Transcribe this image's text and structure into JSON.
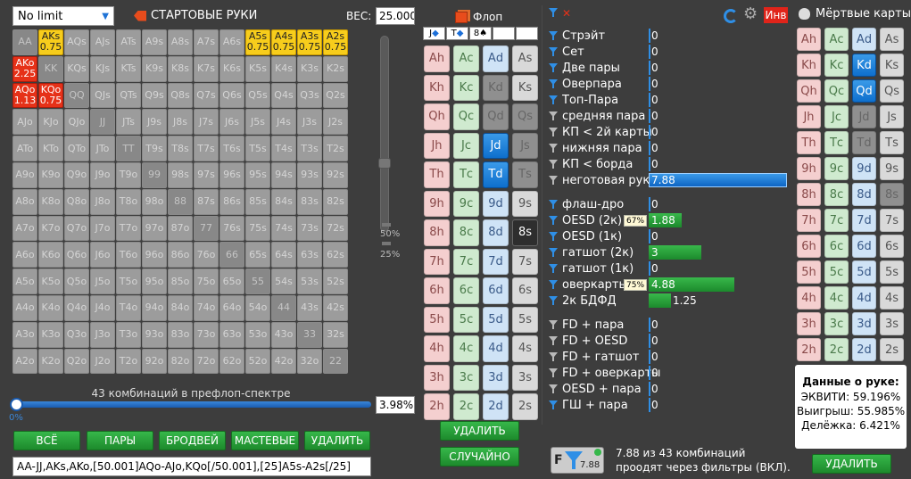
{
  "preset": {
    "value": "No limit"
  },
  "start_hands": {
    "label": "СТАРТОВЫЕ РУКИ"
  },
  "weight": {
    "label": "ВЕС:",
    "value": "25.000"
  },
  "hand_grid": [
    [
      {
        "t": "AA",
        "k": "pair"
      },
      {
        "t": "AKs",
        "w": "0.75",
        "k": "yellow"
      },
      {
        "t": "AQs"
      },
      {
        "t": "AJs"
      },
      {
        "t": "ATs"
      },
      {
        "t": "A9s"
      },
      {
        "t": "A8s"
      },
      {
        "t": "A7s"
      },
      {
        "t": "A6s"
      },
      {
        "t": "A5s",
        "w": "0.75",
        "k": "yellow"
      },
      {
        "t": "A4s",
        "w": "0.75",
        "k": "yellow"
      },
      {
        "t": "A3s",
        "w": "0.75",
        "k": "yellow"
      },
      {
        "t": "A2s",
        "w": "0.75",
        "k": "yellow"
      }
    ],
    [
      {
        "t": "AKo",
        "w": "2.25",
        "k": "red"
      },
      {
        "t": "KK",
        "k": "pair"
      },
      {
        "t": "KQs"
      },
      {
        "t": "KJs"
      },
      {
        "t": "KTs"
      },
      {
        "t": "K9s"
      },
      {
        "t": "K8s"
      },
      {
        "t": "K7s"
      },
      {
        "t": "K6s"
      },
      {
        "t": "K5s"
      },
      {
        "t": "K4s"
      },
      {
        "t": "K3s"
      },
      {
        "t": "K2s"
      }
    ],
    [
      {
        "t": "AQo",
        "w": "1.13",
        "k": "red"
      },
      {
        "t": "KQo",
        "w": "0.75",
        "k": "red"
      },
      {
        "t": "QQ",
        "k": "pair"
      },
      {
        "t": "QJs"
      },
      {
        "t": "QTs"
      },
      {
        "t": "Q9s"
      },
      {
        "t": "Q8s"
      },
      {
        "t": "Q7s"
      },
      {
        "t": "Q6s"
      },
      {
        "t": "Q5s"
      },
      {
        "t": "Q4s"
      },
      {
        "t": "Q3s"
      },
      {
        "t": "Q2s"
      }
    ],
    [
      {
        "t": "AJo"
      },
      {
        "t": "KJo"
      },
      {
        "t": "QJo"
      },
      {
        "t": "JJ",
        "k": "pair"
      },
      {
        "t": "JTs"
      },
      {
        "t": "J9s"
      },
      {
        "t": "J8s"
      },
      {
        "t": "J7s"
      },
      {
        "t": "J6s"
      },
      {
        "t": "J5s"
      },
      {
        "t": "J4s"
      },
      {
        "t": "J3s"
      },
      {
        "t": "J2s"
      }
    ],
    [
      {
        "t": "ATo"
      },
      {
        "t": "KTo"
      },
      {
        "t": "QTo"
      },
      {
        "t": "JTo"
      },
      {
        "t": "TT",
        "k": "pair"
      },
      {
        "t": "T9s"
      },
      {
        "t": "T8s"
      },
      {
        "t": "T7s"
      },
      {
        "t": "T6s"
      },
      {
        "t": "T5s"
      },
      {
        "t": "T4s"
      },
      {
        "t": "T3s"
      },
      {
        "t": "T2s"
      }
    ],
    [
      {
        "t": "A9o"
      },
      {
        "t": "K9o"
      },
      {
        "t": "Q9o"
      },
      {
        "t": "J9o"
      },
      {
        "t": "T9o"
      },
      {
        "t": "99",
        "k": "pair"
      },
      {
        "t": "98s"
      },
      {
        "t": "97s"
      },
      {
        "t": "96s"
      },
      {
        "t": "95s"
      },
      {
        "t": "94s"
      },
      {
        "t": "93s"
      },
      {
        "t": "92s"
      }
    ],
    [
      {
        "t": "A8o"
      },
      {
        "t": "K8o"
      },
      {
        "t": "Q8o"
      },
      {
        "t": "J8o"
      },
      {
        "t": "T8o"
      },
      {
        "t": "98o"
      },
      {
        "t": "88",
        "k": "pair"
      },
      {
        "t": "87s"
      },
      {
        "t": "86s"
      },
      {
        "t": "85s"
      },
      {
        "t": "84s"
      },
      {
        "t": "83s"
      },
      {
        "t": "82s"
      }
    ],
    [
      {
        "t": "A7o"
      },
      {
        "t": "K7o"
      },
      {
        "t": "Q7o"
      },
      {
        "t": "J7o"
      },
      {
        "t": "T7o"
      },
      {
        "t": "97o"
      },
      {
        "t": "87o"
      },
      {
        "t": "77",
        "k": "pair"
      },
      {
        "t": "76s"
      },
      {
        "t": "75s"
      },
      {
        "t": "74s"
      },
      {
        "t": "73s"
      },
      {
        "t": "72s"
      }
    ],
    [
      {
        "t": "A6o"
      },
      {
        "t": "K6o"
      },
      {
        "t": "Q6o"
      },
      {
        "t": "J6o"
      },
      {
        "t": "T6o"
      },
      {
        "t": "96o"
      },
      {
        "t": "86o"
      },
      {
        "t": "76o"
      },
      {
        "t": "66",
        "k": "pair"
      },
      {
        "t": "65s"
      },
      {
        "t": "64s"
      },
      {
        "t": "63s"
      },
      {
        "t": "62s"
      }
    ],
    [
      {
        "t": "A5o"
      },
      {
        "t": "K5o"
      },
      {
        "t": "Q5o"
      },
      {
        "t": "J5o"
      },
      {
        "t": "T5o"
      },
      {
        "t": "95o"
      },
      {
        "t": "85o"
      },
      {
        "t": "75o"
      },
      {
        "t": "65o"
      },
      {
        "t": "55",
        "k": "pair"
      },
      {
        "t": "54s"
      },
      {
        "t": "53s"
      },
      {
        "t": "52s"
      }
    ],
    [
      {
        "t": "A4o"
      },
      {
        "t": "K4o"
      },
      {
        "t": "Q4o"
      },
      {
        "t": "J4o"
      },
      {
        "t": "T4o"
      },
      {
        "t": "94o"
      },
      {
        "t": "84o"
      },
      {
        "t": "74o"
      },
      {
        "t": "64o"
      },
      {
        "t": "54o"
      },
      {
        "t": "44",
        "k": "pair"
      },
      {
        "t": "43s"
      },
      {
        "t": "42s"
      }
    ],
    [
      {
        "t": "A3o"
      },
      {
        "t": "K3o"
      },
      {
        "t": "Q3o"
      },
      {
        "t": "J3o"
      },
      {
        "t": "T3o"
      },
      {
        "t": "93o"
      },
      {
        "t": "83o"
      },
      {
        "t": "73o"
      },
      {
        "t": "63o"
      },
      {
        "t": "53o"
      },
      {
        "t": "43o"
      },
      {
        "t": "33",
        "k": "pair"
      },
      {
        "t": "32s"
      }
    ],
    [
      {
        "t": "A2o"
      },
      {
        "t": "K2o"
      },
      {
        "t": "Q2o"
      },
      {
        "t": "J2o"
      },
      {
        "t": "T2o"
      },
      {
        "t": "92o"
      },
      {
        "t": "82o"
      },
      {
        "t": "72o"
      },
      {
        "t": "62o"
      },
      {
        "t": "52o"
      },
      {
        "t": "42o"
      },
      {
        "t": "32o"
      },
      {
        "t": "22",
        "k": "pair"
      }
    ]
  ],
  "weight_slider": {
    "mark_50": "50%",
    "mark_25": "25%"
  },
  "range_slider": {
    "combos_label": "43 комбинаций в префлоп-спектре",
    "min_label": "0%",
    "percent": "3.98%",
    "fill": 0.0
  },
  "range_buttons": {
    "all": "ВСЁ",
    "pairs": "ПАРЫ",
    "broadway": "БРОДВЕЙ",
    "suited": "МАСТЕВЫЕ",
    "delete": "УДАЛИТЬ"
  },
  "range_text": "AA-JJ,AKs,AKo,[50.001]AQo-AJo,KQo[/50.001],[25]A5s-A2s[/25]",
  "flop": {
    "title": "Флоп",
    "slots": [
      {
        "rank": "J",
        "suit": "◆"
      },
      {
        "rank": "T",
        "suit": "◆"
      },
      {
        "rank": "8",
        "suit": "♠"
      },
      {
        "rank": "",
        "suit": ""
      },
      {
        "rank": "",
        "suit": ""
      }
    ],
    "ranks": [
      "A",
      "K",
      "Q",
      "J",
      "T",
      "9",
      "8",
      "7",
      "6",
      "5",
      "4",
      "3",
      "2"
    ],
    "suits": [
      "h",
      "c",
      "d",
      "s"
    ],
    "selected": [
      "Jd",
      "Td",
      "8s"
    ],
    "unavailable": [
      "Kd",
      "Qd",
      "Qs",
      "Js",
      "Ts"
    ],
    "delete_label": "УДАЛИТЬ",
    "random_label": "СЛУЧАЙНО"
  },
  "filters": {
    "inv_label": "Инв",
    "groups": [
      [
        {
          "label": "Стрэйт",
          "value": "0",
          "on": true
        },
        {
          "label": "Сет",
          "value": "0",
          "on": true
        },
        {
          "label": "Две пары",
          "value": "0",
          "on": true
        },
        {
          "label": "Оверпара",
          "value": "0",
          "on": true
        },
        {
          "label": "Топ-Пара",
          "value": "0",
          "on": true
        },
        {
          "label": "средняя пара",
          "value": "0",
          "on": false
        },
        {
          "label": "КП < 2й карты",
          "value": "0",
          "on": false
        },
        {
          "label": "нижняя пара",
          "value": "0",
          "on": false
        },
        {
          "label": "КП < борда",
          "value": "0",
          "on": false
        },
        {
          "label": "неготовая рука",
          "value": "7.88",
          "on": false,
          "bar": "blue",
          "fill": 1.0
        }
      ],
      [
        {
          "label": "флаш-дро",
          "value": "0",
          "on": true
        },
        {
          "label": "OESD (2к)",
          "value": "1.88",
          "on": true,
          "bar": "green",
          "fill": 0.24,
          "pct": "67%"
        },
        {
          "label": "OESD (1к)",
          "value": "0",
          "on": true
        },
        {
          "label": "гатшот (2к)",
          "value": "3",
          "on": true,
          "bar": "green",
          "fill": 0.38
        },
        {
          "label": "гатшот (1к)",
          "value": "0",
          "on": true
        },
        {
          "label": "оверкарты",
          "value": "4.88",
          "on": true,
          "bar": "green",
          "fill": 0.62,
          "pct": "75%"
        },
        {
          "label": "2к БДФД",
          "value": "1.25",
          "on": true,
          "bar": "green",
          "fill": 0.16
        }
      ],
      [
        {
          "label": "FD + пара",
          "value": "0",
          "on": false
        },
        {
          "label": "FD + OESD",
          "value": "0",
          "on": false
        },
        {
          "label": "FD + гатшот",
          "value": "0",
          "on": false
        },
        {
          "label": "FD + оверкарты",
          "value": "0",
          "on": false
        },
        {
          "label": "OESD + пара",
          "value": "0",
          "on": false
        },
        {
          "label": "ГШ + пара",
          "value": "0",
          "on": true
        }
      ]
    ],
    "summary_value": "7.88",
    "summary_line1": "7.88 из 43 комбинаций",
    "summary_line2": "проодят через фильтры (ВКЛ)."
  },
  "dead_cards": {
    "title": "Мёртвые карты",
    "selected": [
      "Kd",
      "Qd"
    ],
    "unavailable": [
      "Jd",
      "Td",
      "8s"
    ],
    "delete_label": "УДАЛИТЬ"
  },
  "hand_data": {
    "title": "Данные о руке:",
    "equity": "ЭКВИТИ: 59.196%",
    "win": "Выигрыш: 55.985%",
    "tie": "Делёжка: 6.421%"
  },
  "colors": {
    "accent_blue": "#2f8fe6",
    "green_button": "#36b74a",
    "red_hand": "#e63118",
    "yellow_hand": "#f7cd1c"
  }
}
